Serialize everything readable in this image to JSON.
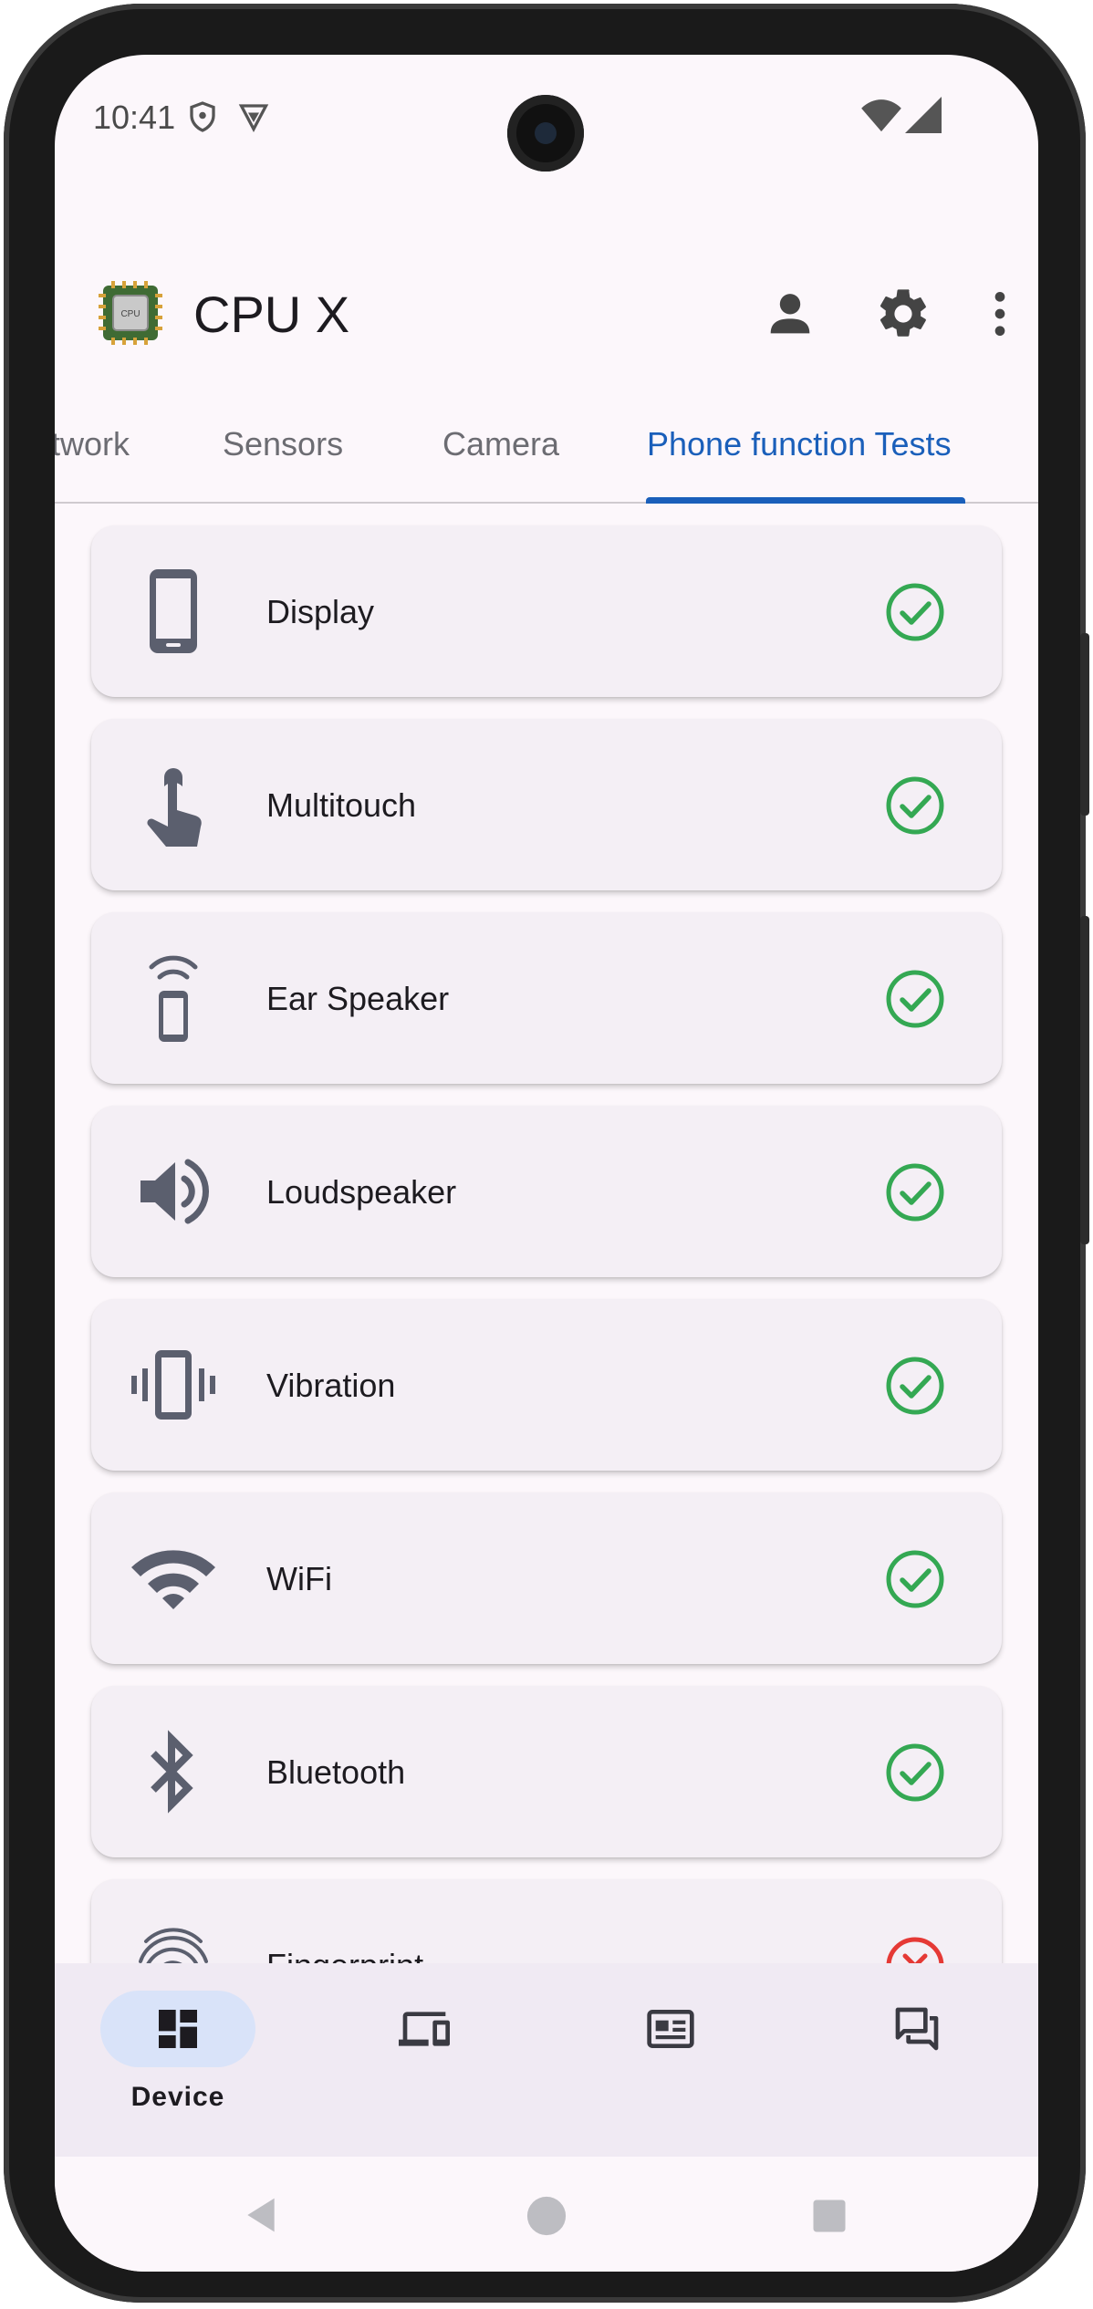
{
  "status_bar": {
    "time": "10:41",
    "icons": [
      "shield-icon",
      "vpn-icon",
      "wifi-signal-icon",
      "cell-signal-icon"
    ]
  },
  "app_bar": {
    "title": "CPU X",
    "logo_text": "CPU",
    "actions": [
      "account-icon",
      "settings-gear-icon",
      "more-vert-icon"
    ]
  },
  "tabs": [
    {
      "label": "twork",
      "active": false
    },
    {
      "label": "Sensors",
      "active": false
    },
    {
      "label": "Camera",
      "active": false
    },
    {
      "label": "Phone function Tests",
      "active": true
    }
  ],
  "tests": [
    {
      "label": "Display",
      "icon": "smartphone-icon",
      "status": "passed"
    },
    {
      "label": "Multitouch",
      "icon": "touch-hand-icon",
      "status": "passed"
    },
    {
      "label": "Ear Speaker",
      "icon": "ear-speaker-icon",
      "status": "passed"
    },
    {
      "label": "Loudspeaker",
      "icon": "volume-icon",
      "status": "passed"
    },
    {
      "label": "Vibration",
      "icon": "vibration-icon",
      "status": "passed"
    },
    {
      "label": "WiFi",
      "icon": "wifi-icon",
      "status": "passed"
    },
    {
      "label": "Bluetooth",
      "icon": "bluetooth-icon",
      "status": "passed"
    },
    {
      "label": "Fingerprint",
      "icon": "fingerprint-icon",
      "status": "failed"
    }
  ],
  "bottom_nav": [
    {
      "label": "Device",
      "icon": "dashboard-icon",
      "active": true
    },
    {
      "label": "",
      "icon": "devices-icon",
      "active": false
    },
    {
      "label": "",
      "icon": "news-icon",
      "active": false
    },
    {
      "label": "",
      "icon": "chat-icon",
      "active": false
    }
  ],
  "colors": {
    "accent": "#1a5fba",
    "pass": "#34a853",
    "fail": "#e53935",
    "icon_gray": "#5b5f6e"
  }
}
